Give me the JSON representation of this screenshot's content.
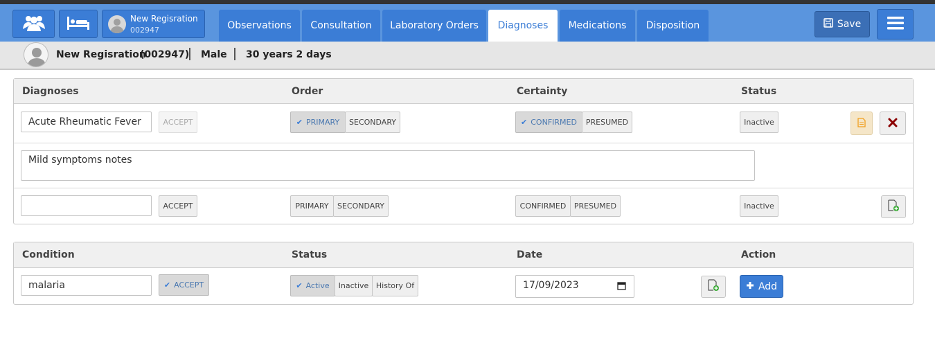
{
  "header": {
    "patient_name": "New Regisration",
    "patient_id": "002947",
    "tabs": [
      {
        "label": "Observations"
      },
      {
        "label": "Consultation"
      },
      {
        "label": "Laboratory Orders"
      },
      {
        "label": "Diagnoses"
      },
      {
        "label": "Medications"
      },
      {
        "label": "Disposition"
      }
    ],
    "active_tab": "Diagnoses",
    "save_label": "Save"
  },
  "patient_bar": {
    "name": "New Regisration",
    "id": "(002947)",
    "gender": "Male",
    "age": "30 years 2 days"
  },
  "diagnoses": {
    "columns": [
      "Diagnoses",
      "Order",
      "Certainty",
      "Status"
    ],
    "existing": {
      "diagnosis": "Acute Rheumatic Fever",
      "accept_label": "ACCEPT",
      "order_options": [
        "PRIMARY",
        "SECONDARY"
      ],
      "order_selected": "PRIMARY",
      "certainty_options": [
        "CONFIRMED",
        "PRESUMED"
      ],
      "certainty_selected": "CONFIRMED",
      "status": "Inactive",
      "notes": "Mild symptoms notes"
    },
    "new": {
      "diagnosis": "",
      "accept_label": "ACCEPT",
      "order_options": [
        "PRIMARY",
        "SECONDARY"
      ],
      "certainty_options": [
        "CONFIRMED",
        "PRESUMED"
      ],
      "status": "Inactive"
    }
  },
  "conditions": {
    "columns": [
      "Condition",
      "Status",
      "Date",
      "Action"
    ],
    "row": {
      "condition": "malaria",
      "accept_label": "ACCEPT",
      "status_options": [
        "Active",
        "Inactive",
        "History Of"
      ],
      "status_selected": "Active",
      "date": "17/09/2023",
      "add_label": "Add"
    }
  },
  "colors": {
    "header_bg": "#5a95de",
    "tab_bg": "#3b7dd6",
    "accent": "#3b7dd6",
    "delete_icon": "#8b0000",
    "note_icon": "#f0a020",
    "add_doc_icon": "#3aaa35"
  },
  "icons": {
    "patients": "users-group-icon",
    "bed": "bed-icon",
    "save": "floppy-disk-icon",
    "menu": "hamburger-menu-icon",
    "note": "document-note-icon",
    "delete": "close-x-icon",
    "add_document": "document-plus-icon",
    "add": "plus-icon",
    "calendar": "calendar-icon"
  }
}
